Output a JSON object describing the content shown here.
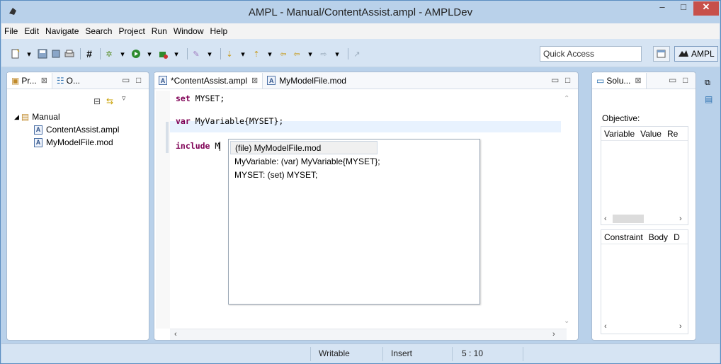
{
  "window": {
    "title": "AMPL - Manual/ContentAssist.ampl - AMPLDev",
    "min_label": "–",
    "max_label": "□",
    "close_label": "✕"
  },
  "menu": [
    "File",
    "Edit",
    "Navigate",
    "Search",
    "Project",
    "Run",
    "Window",
    "Help"
  ],
  "toolbar": {
    "quick_access_label": "Quick Access",
    "perspective_label": "AMPL"
  },
  "project_panel": {
    "tabs": [
      {
        "label": "Pr..."
      },
      {
        "label": "O..."
      }
    ],
    "tree": {
      "root": "Manual",
      "children": [
        "ContentAssist.ampl",
        "MyModelFile.mod"
      ]
    }
  },
  "editor": {
    "tabs": [
      {
        "label": "*ContentAssist.ampl",
        "active": true
      },
      {
        "label": "MyModelFile.mod",
        "active": false
      }
    ],
    "lines": [
      {
        "kw": "set",
        "rest": " MYSET;"
      },
      {
        "kw": "var",
        "rest": " MyVariable{MYSET};"
      },
      {
        "kw": "include",
        "rest": " M"
      }
    ],
    "completions": [
      "(file) MyModelFile.mod",
      "MyVariable: (var) MyVariable{MYSET};",
      "MYSET: (set) MYSET;"
    ]
  },
  "solution_panel": {
    "tab_label": "Solu...",
    "objective_label": "Objective:",
    "variable_columns": [
      "Variable",
      "Value",
      "Re"
    ],
    "constraint_columns": [
      "Constraint",
      "Body",
      "D"
    ]
  },
  "status": {
    "mode": "Writable",
    "insert": "Insert",
    "position": "5 : 10"
  },
  "colors": {
    "keyword": "#7f0055",
    "frame": "#b9d1ea",
    "close_button": "#c7504a"
  }
}
